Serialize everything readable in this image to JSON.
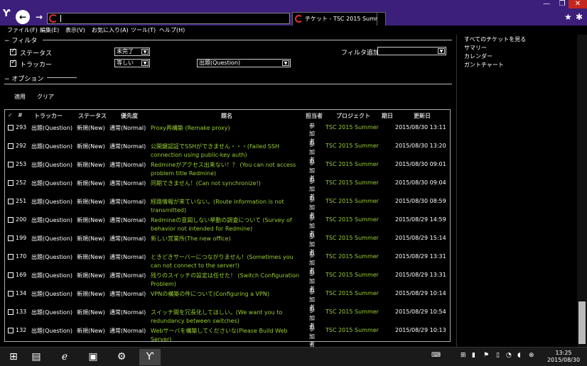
{
  "browser": {
    "tab_title": "チケット - TSC 2015 Summ...",
    "star_icon": "★",
    "gear_icon": "✱",
    "min_icon": "—",
    "max_icon": "❐",
    "close_icon": "✕"
  },
  "menu": [
    "ファイル(F)",
    "編集(E)",
    "表示(V)",
    "お気に入り(A)",
    "ツール(T)",
    "ヘルプ(H)"
  ],
  "filters": {
    "section_label": "フィルタ",
    "status_label": "ステータス",
    "status_operator": "未完了",
    "tracker_label": "トラッカー",
    "tracker_operator": "等しい",
    "tracker_value": "出題(Question)",
    "add_filter_label": "フィルタ追加",
    "add_filter_value": ""
  },
  "options": {
    "section_label": "オプション"
  },
  "actions": {
    "apply": "適用",
    "clear": "クリア"
  },
  "table": {
    "headers": {
      "check": "✓",
      "id": "#",
      "tracker": "トラッカー",
      "status": "ステータス",
      "priority": "優先度",
      "subject": "題名",
      "assignee": "担当者",
      "project": "プロジェクト",
      "due": "期日",
      "updated": "更新日"
    },
    "rows": [
      {
        "id": "293",
        "tracker": "出題(Question)",
        "status": "新規(New)",
        "priority": "通常(Normal)",
        "subject": "Proxy再構築 (Remake proxy)",
        "assignee": "参加者",
        "project": "TSC 2015 Summer",
        "updated": "2015/08/30 13:11"
      },
      {
        "id": "292",
        "tracker": "出題(Question)",
        "status": "新規(New)",
        "priority": "通常(Normal)",
        "subject": "公開鍵認証でSSHができません・・・(Failed SSH connection using public-key auth)",
        "assignee": "参加者",
        "project": "TSC 2015 Summer",
        "updated": "2015/08/30 13:20"
      },
      {
        "id": "253",
        "tracker": "出題(Question)",
        "status": "新規(New)",
        "priority": "通常(Normal)",
        "subject": "Redmineがアクセス出来ない！？ (You can not access problem title Redmine)",
        "assignee": "参加者",
        "project": "TSC 2015 Summer",
        "updated": "2015/08/30 09:01"
      },
      {
        "id": "252",
        "tracker": "出題(Question)",
        "status": "新規(New)",
        "priority": "通常(Normal)",
        "subject": "同期できません！(Can not synchronize!)",
        "assignee": "参加者",
        "project": "TSC 2015 Summer",
        "updated": "2015/08/30 09:04"
      },
      {
        "id": "251",
        "tracker": "出題(Question)",
        "status": "新規(New)",
        "priority": "通常(Normal)",
        "subject": "経路情報が来ていない。(Route information is not transmitted)",
        "assignee": "参加者",
        "project": "TSC 2015 Summer",
        "updated": "2015/08/30 08:59"
      },
      {
        "id": "200",
        "tracker": "出題(Question)",
        "status": "新規(New)",
        "priority": "通常(Normal)",
        "subject": "Redmineの意図しない挙動の調査について (Survey of behavior not intended for Redmine)",
        "assignee": "参加者",
        "project": "TSC 2015 Summer",
        "updated": "2015/08/29 14:59"
      },
      {
        "id": "199",
        "tracker": "出題(Question)",
        "status": "新規(New)",
        "priority": "通常(Normal)",
        "subject": "新しい営業所(The new office)",
        "assignee": "参加者",
        "project": "TSC 2015 Summer",
        "updated": "2015/08/29 15:14"
      },
      {
        "id": "170",
        "tracker": "出題(Question)",
        "status": "新規(New)",
        "priority": "通常(Normal)",
        "subject": "ときどきサーバーにつながりません！(Sometimes you can not connect to the server!)",
        "assignee": "参加者",
        "project": "TSC 2015 Summer",
        "updated": "2015/08/29 13:31"
      },
      {
        "id": "169",
        "tracker": "出題(Question)",
        "status": "新規(New)",
        "priority": "通常(Normal)",
        "subject": "残りのスイッチの設定は任せた！ (Switch Configuration Problem)",
        "assignee": "参加者",
        "project": "TSC 2015 Summer",
        "updated": "2015/08/29 13:31"
      },
      {
        "id": "134",
        "tracker": "出題(Question)",
        "status": "新規(New)",
        "priority": "通常(Normal)",
        "subject": "VPNの構築の件について(Configuring a VPN)",
        "assignee": "参加者",
        "project": "TSC 2015 Summer",
        "updated": "2015/08/29 10:14"
      },
      {
        "id": "133",
        "tracker": "出題(Question)",
        "status": "新規(New)",
        "priority": "通常(Normal)",
        "subject": "スイッチ間を冗長化してほしい。(We want you to redundancy between switches)",
        "assignee": "参加者",
        "project": "TSC 2015 Summer",
        "updated": "2015/08/29 10:54"
      },
      {
        "id": "132",
        "tracker": "出題(Question)",
        "status": "新規(New)",
        "priority": "通常(Normal)",
        "subject": "Webサーバを構築してくださいな(Please Build Web Server)",
        "assignee": "参加者",
        "project": "TSC 2015 Summer",
        "updated": "2015/08/29 10:13"
      }
    ]
  },
  "sidebar": {
    "links": [
      "すべてのチケットを見る",
      "サマリー",
      "カレンダー",
      "ガントチャート"
    ]
  },
  "taskbar": {
    "time": "13:25",
    "date": "2015/08/30"
  }
}
